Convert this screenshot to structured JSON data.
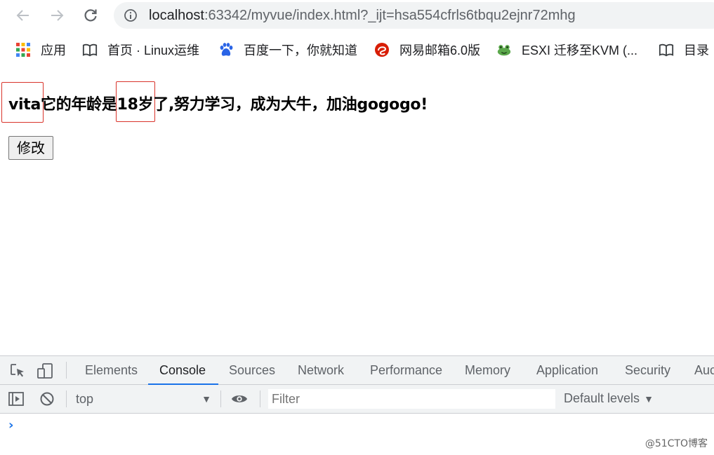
{
  "browser": {
    "url_host": "localhost",
    "url_rest": ":63342/myvue/index.html?_ijt=hsa554cfrls6tbqu2ejnr72mhg",
    "icons": {
      "back": "arrow-left-icon",
      "forward": "arrow-right-icon",
      "reload": "reload-icon",
      "info": "info-icon"
    }
  },
  "bookmarks": [
    {
      "label": "应用",
      "icon": "apps-grid-icon"
    },
    {
      "label": "首页 · Linux运维",
      "icon": "book-icon"
    },
    {
      "label": "百度一下，你就知道",
      "icon": "baidu-paw-icon"
    },
    {
      "label": "网易邮箱6.0版",
      "icon": "netease-mail-icon"
    },
    {
      "label": "ESXI 迁移至KVM (...",
      "icon": "frog-icon"
    },
    {
      "label": "目录",
      "icon": "book-icon"
    }
  ],
  "page": {
    "name": "vita",
    "text_a": "它的年龄是",
    "age": "18",
    "text_b": "岁",
    "text_c": "了,努力学习，成为大牛，加油gogogo!",
    "modify_button": "修改",
    "highlight_color": "#d9342b"
  },
  "devtools": {
    "tabs": [
      "Elements",
      "Console",
      "Sources",
      "Network",
      "Performance",
      "Memory",
      "Application",
      "Security",
      "Auc"
    ],
    "active_tab": "Console",
    "context": "top",
    "filter_placeholder": "Filter",
    "levels": "Default levels",
    "prompt_symbol": "›",
    "accent_color": "#1a73e8"
  },
  "watermark": "@51CTO博客"
}
